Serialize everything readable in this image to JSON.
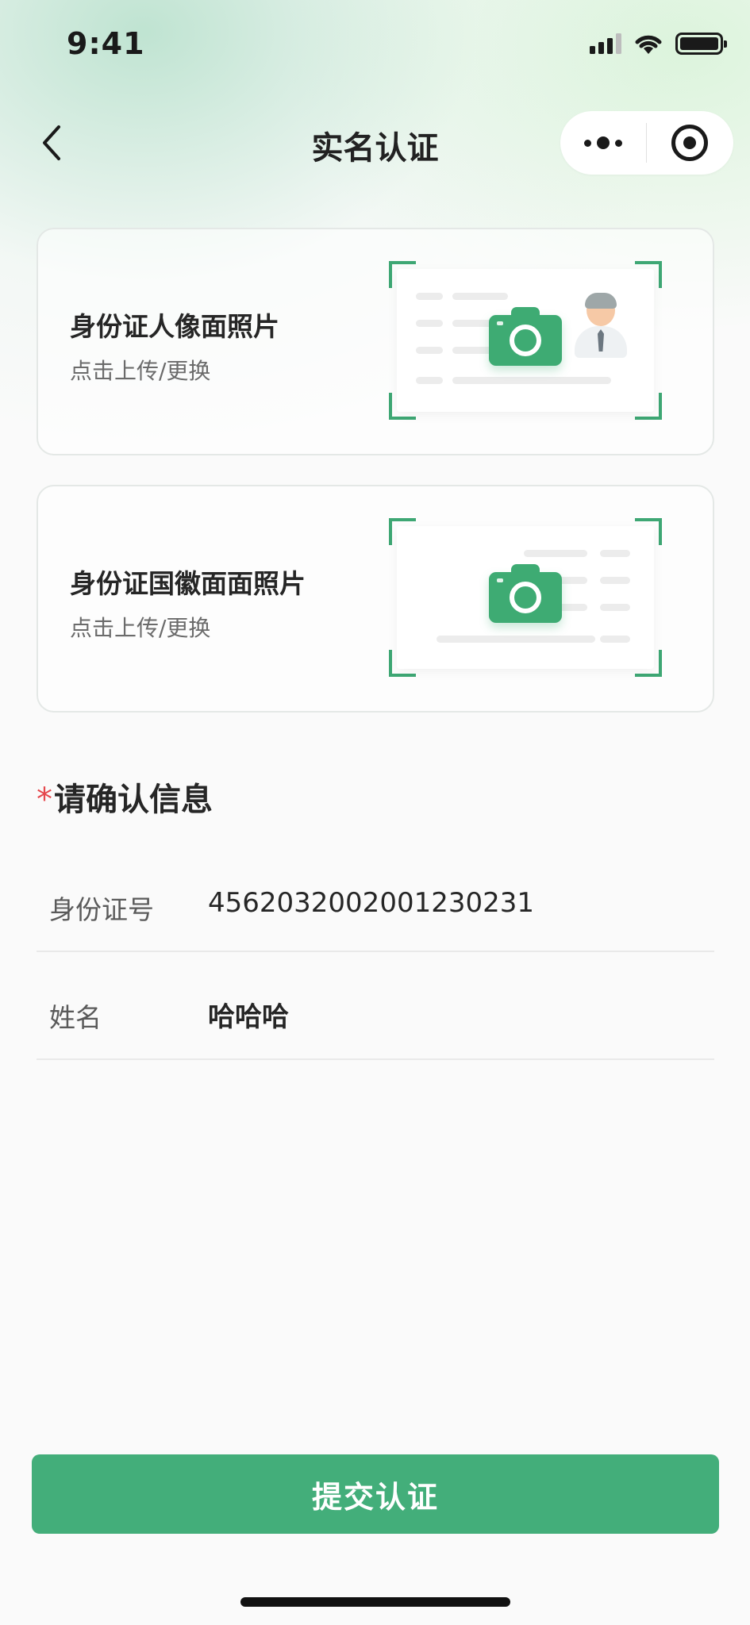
{
  "status_bar": {
    "time": "9:41",
    "icons": [
      "signal-icon",
      "wifi-icon",
      "battery-icon"
    ]
  },
  "nav": {
    "back_icon": "chevron-left-icon",
    "title": "实名认证",
    "capsule": {
      "more_icon": "more-dots-icon",
      "close_icon": "target-circle-icon"
    }
  },
  "upload_cards": [
    {
      "title": "身份证人像面照片",
      "subtitle": "点击上传/更换",
      "icon": "camera-icon"
    },
    {
      "title": "身份证国徽面面照片",
      "subtitle": "点击上传/更换",
      "icon": "camera-icon"
    }
  ],
  "confirm_section": {
    "required_mark": "*",
    "title": "请确认信息",
    "fields": [
      {
        "label": "身份证号",
        "value": "456203200200123023​1"
      },
      {
        "label": "姓名",
        "value": "哈哈哈"
      }
    ]
  },
  "submit": {
    "label": "提交认证"
  },
  "colors": {
    "accent": "#43ae7a",
    "frame_corner": "#3ea774",
    "required": "#e5484d"
  }
}
